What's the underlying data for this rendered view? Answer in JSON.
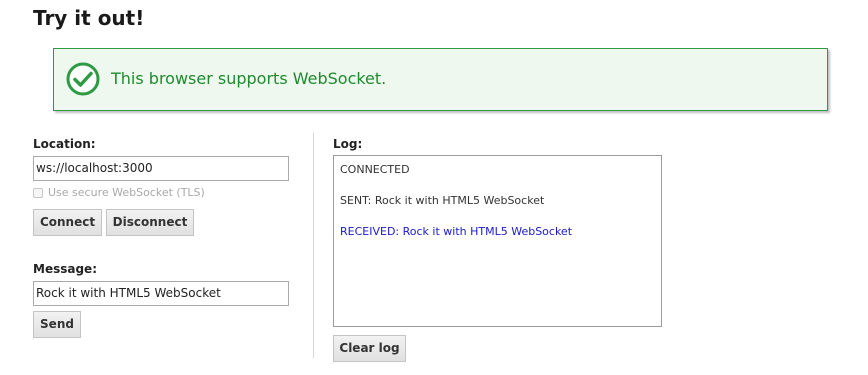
{
  "heading": "Try it out!",
  "support_message": "This browser supports WebSocket.",
  "colors": {
    "success_border": "#2e9a44",
    "success_text": "#1f8a30",
    "received_text": "#1a1acc"
  },
  "location": {
    "label": "Location:",
    "value": "ws://localhost:3000",
    "tls_label": "Use secure WebSocket (TLS)",
    "tls_checked": false,
    "connect_label": "Connect",
    "disconnect_label": "Disconnect"
  },
  "message": {
    "label": "Message:",
    "value": "Rock it with HTML5 WebSocket",
    "send_label": "Send"
  },
  "log": {
    "label": "Log:",
    "entries": [
      {
        "text": "CONNECTED",
        "kind": "normal"
      },
      {
        "text": "SENT: Rock it with HTML5 WebSocket",
        "kind": "normal"
      },
      {
        "text": "RECEIVED: Rock it with HTML5 WebSocket",
        "kind": "received"
      }
    ],
    "clear_label": "Clear log"
  }
}
